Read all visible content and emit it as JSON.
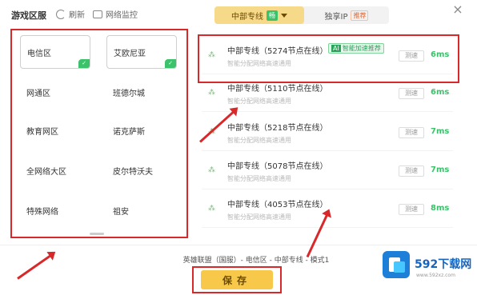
{
  "header": {
    "region_title": "游戏区服",
    "refresh_label": "刷新",
    "monitor_label": "网络监控",
    "line_tab": {
      "label": "中部专线",
      "badge": "畅"
    },
    "ip_tab": {
      "label": "独享IP",
      "badge": "推荐"
    }
  },
  "regions": [
    {
      "label": "电信区",
      "selected": true
    },
    {
      "label": "艾欧尼亚",
      "selected": true
    },
    {
      "label": "网通区",
      "selected": false
    },
    {
      "label": "班德尔城",
      "selected": false
    },
    {
      "label": "教育网区",
      "selected": false
    },
    {
      "label": "诺克萨斯",
      "selected": false
    },
    {
      "label": "全网络大区",
      "selected": false
    },
    {
      "label": "皮尔特沃夫",
      "selected": false
    },
    {
      "label": "特殊网络",
      "selected": false
    },
    {
      "label": "祖安",
      "selected": false
    }
  ],
  "lines": [
    {
      "name": "中部专线（5274节点在线）",
      "desc": "智能分配网络高速通用",
      "tag_ai": "AI",
      "tag": "智能加速推荐",
      "speed_btn": "测速",
      "ms": "6ms"
    },
    {
      "name": "中部专线（5110节点在线）",
      "desc": "智能分配网络高速通用",
      "tag_ai": "",
      "tag": "",
      "speed_btn": "测速",
      "ms": "6ms"
    },
    {
      "name": "中部专线（5218节点在线）",
      "desc": "智能分配网络高速通用",
      "tag_ai": "",
      "tag": "",
      "speed_btn": "测速",
      "ms": "7ms"
    },
    {
      "name": "中部专线（5078节点在线）",
      "desc": "智能分配网络高速通用",
      "tag_ai": "",
      "tag": "",
      "speed_btn": "测速",
      "ms": "7ms"
    },
    {
      "name": "中部专线（4053节点在线）",
      "desc": "智能分配网络高速通用",
      "tag_ai": "",
      "tag": "",
      "speed_btn": "测速",
      "ms": "8ms"
    }
  ],
  "footer": {
    "status": "英雄联盟（国服）- 电信区 - 中部专线 - 模式1",
    "save_label": "保存"
  },
  "watermark": {
    "name": "592下载网",
    "url": "www.592xz.com"
  },
  "colors": {
    "accent": "#f7c84a",
    "highlight": "#d8282a",
    "good": "#3cc26a"
  }
}
